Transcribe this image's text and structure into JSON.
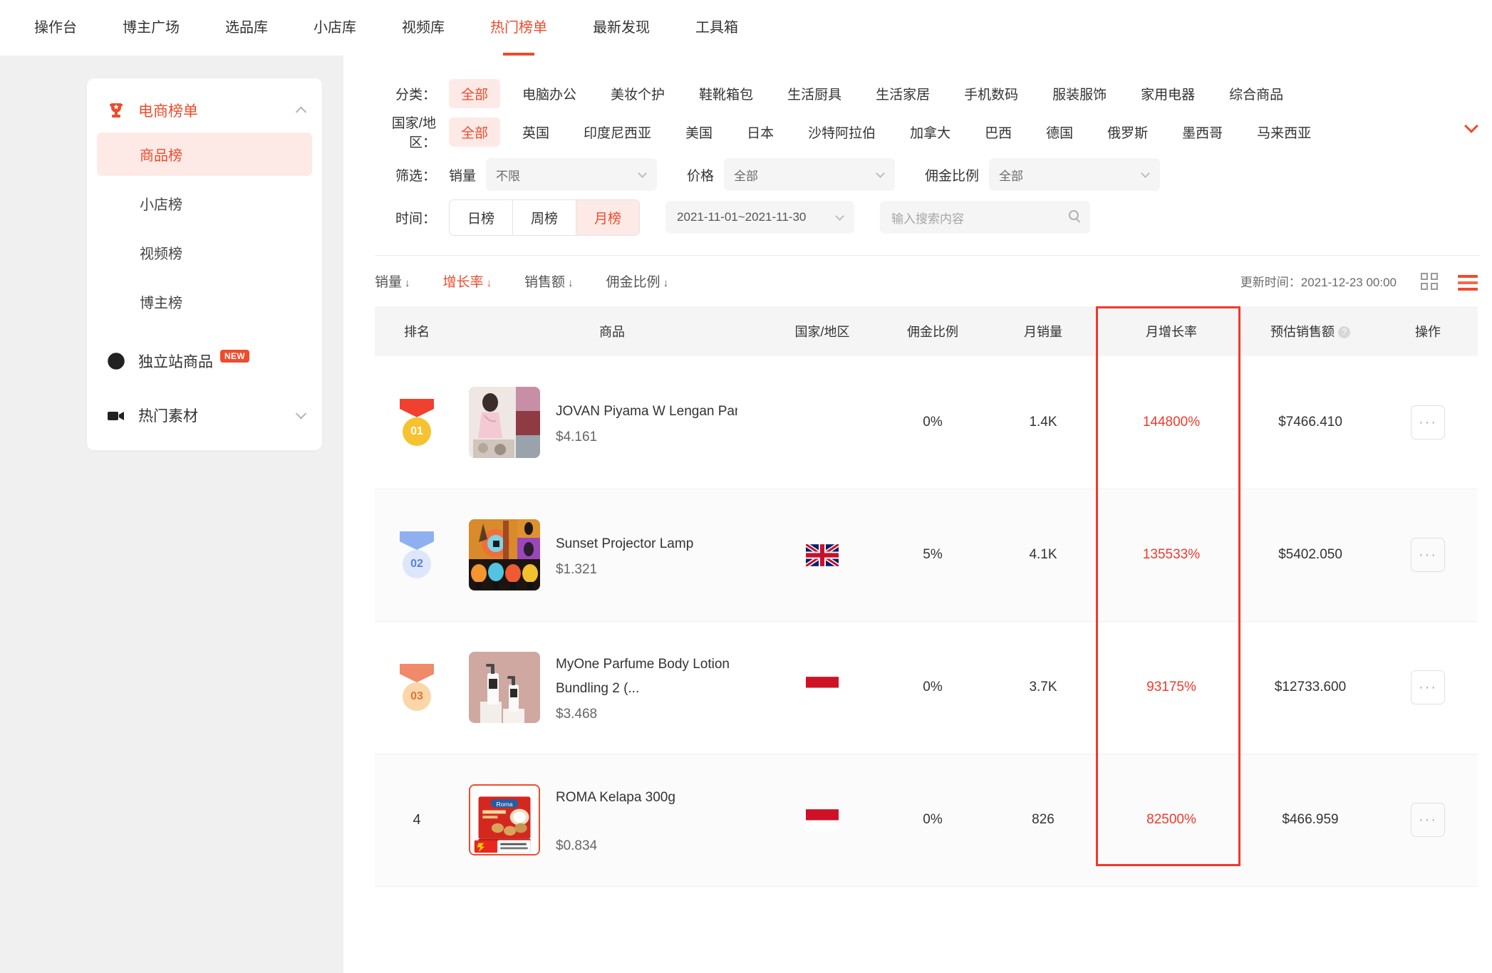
{
  "topnav": {
    "items": [
      {
        "label": "操作台",
        "active": false
      },
      {
        "label": "博主广场",
        "active": false
      },
      {
        "label": "选品库",
        "active": false
      },
      {
        "label": "小店库",
        "active": false
      },
      {
        "label": "视频库",
        "active": false
      },
      {
        "label": "热门榜单",
        "active": true
      },
      {
        "label": "最新发现",
        "active": false
      },
      {
        "label": "工具箱",
        "active": false
      }
    ]
  },
  "sidebar": {
    "group_label": "电商榜单",
    "group_icon": "trophy-icon",
    "sub_items": [
      {
        "label": "商品榜",
        "active": true
      },
      {
        "label": "小店榜",
        "active": false
      },
      {
        "label": "视频榜",
        "active": false
      },
      {
        "label": "博主榜",
        "active": false
      }
    ],
    "independent": {
      "label": "独立站商品",
      "badge": "NEW",
      "icon": "circle-icon"
    },
    "hot_material": {
      "label": "热门素材",
      "icon": "video-camera-icon"
    }
  },
  "filters": {
    "category": {
      "label": "分类：",
      "options": [
        "全部",
        "电脑办公",
        "美妆个护",
        "鞋靴箱包",
        "生活厨具",
        "生活家居",
        "手机数码",
        "服装服饰",
        "家用电器",
        "综合商品"
      ],
      "selected": "全部"
    },
    "country": {
      "label": "国家/地区：",
      "options": [
        "全部",
        "英国",
        "印度尼西亚",
        "美国",
        "日本",
        "沙特阿拉伯",
        "加拿大",
        "巴西",
        "德国",
        "俄罗斯",
        "墨西哥",
        "马来西亚"
      ],
      "selected": "全部"
    },
    "screen": {
      "label": "筛选：",
      "sales": {
        "label": "销量",
        "value": "不限"
      },
      "price": {
        "label": "价格",
        "value": "全部"
      },
      "commission": {
        "label": "佣金比例",
        "value": "全部"
      }
    },
    "time": {
      "label": "时间：",
      "segments": [
        {
          "label": "日榜",
          "active": false
        },
        {
          "label": "周榜",
          "active": false
        },
        {
          "label": "月榜",
          "active": true
        }
      ],
      "date_range": "2021-11-01~2021-11-30",
      "search_placeholder": "输入搜索内容"
    }
  },
  "sortbar": {
    "items": [
      {
        "label": "销量",
        "arrow": "↓",
        "active": false
      },
      {
        "label": "增长率",
        "arrow": "↓",
        "active": true
      },
      {
        "label": "销售额",
        "arrow": "↓",
        "active": false
      },
      {
        "label": "佣金比例",
        "arrow": "↓",
        "active": false
      }
    ],
    "update_time": "更新时间：2021-12-23 00:00",
    "grid_icon": "grid-view-icon",
    "list_icon": "list-view-icon"
  },
  "table": {
    "headers": {
      "rank": "排名",
      "product": "商品",
      "country": "国家/地区",
      "commission": "佣金比例",
      "monthly_sales": "月销量",
      "monthly_growth": "月增长率",
      "est_sales_amount": "预估销售额",
      "ops": "操作"
    },
    "rows": [
      {
        "rank": "01",
        "rank_style": "medal-gold",
        "name": "JOVAN Piyama W  Lengan Panjang",
        "price": "$4.161",
        "country": "",
        "commission": "0%",
        "monthly_sales": "1.4K",
        "monthly_growth": "144800%",
        "est_sales": "$7466.410",
        "ops": "···"
      },
      {
        "rank": "02",
        "rank_style": "medal-silver",
        "name": "Sunset Projector Lamp",
        "price": "$1.321",
        "country": "uk-flag",
        "commission": "5%",
        "monthly_sales": "4.1K",
        "monthly_growth": "135533%",
        "est_sales": "$5402.050",
        "ops": "···"
      },
      {
        "rank": "03",
        "rank_style": "medal-bronze",
        "name": "MyOne Parfume Body Lotion Bundling 2 (...",
        "price": "$3.468",
        "country": "indonesia-flag",
        "commission": "0%",
        "monthly_sales": "3.7K",
        "monthly_growth": "93175%",
        "est_sales": "$12733.600",
        "ops": "···"
      },
      {
        "rank": "4",
        "rank_style": "plain",
        "name": "ROMA Kelapa 300g",
        "price": "$0.834",
        "country": "indonesia-flag",
        "commission": "0%",
        "monthly_sales": "826",
        "monthly_growth": "82500%",
        "est_sales": "$466.959",
        "ops": "···"
      }
    ]
  },
  "colors": {
    "accent": "#ef4b2c",
    "growth_red": "#f0392b",
    "highlight_border": "#f0392b"
  }
}
